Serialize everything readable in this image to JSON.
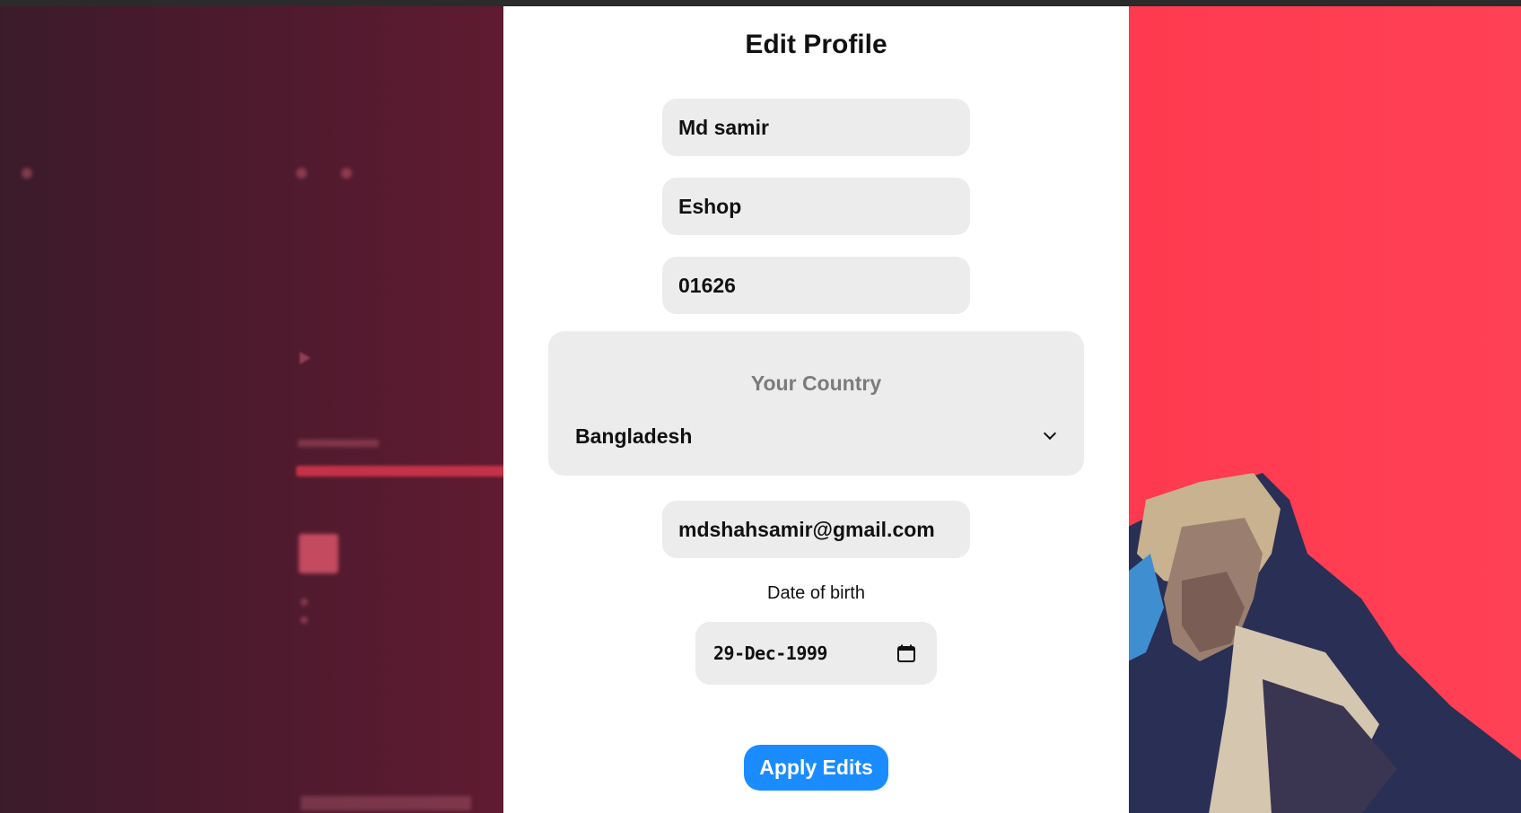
{
  "form": {
    "title": "Edit Profile",
    "first_name": "Md samir",
    "last_name": "Eshop",
    "phone": "01626",
    "country_label": "Your Country",
    "country_value": "Bangladesh",
    "email": "mdshahsamir@gmail.com",
    "dob_label": "Date of birth",
    "dob_value": "29-Dec-1999",
    "submit_label": "Apply Edits"
  },
  "colors": {
    "accent": "#1a8cff",
    "field_bg": "#ececec",
    "background_right": "#ff3d52",
    "background_left": "#4e1a2e"
  },
  "icons": {
    "dropdown": "chevron-down-icon",
    "date": "calendar-icon"
  }
}
